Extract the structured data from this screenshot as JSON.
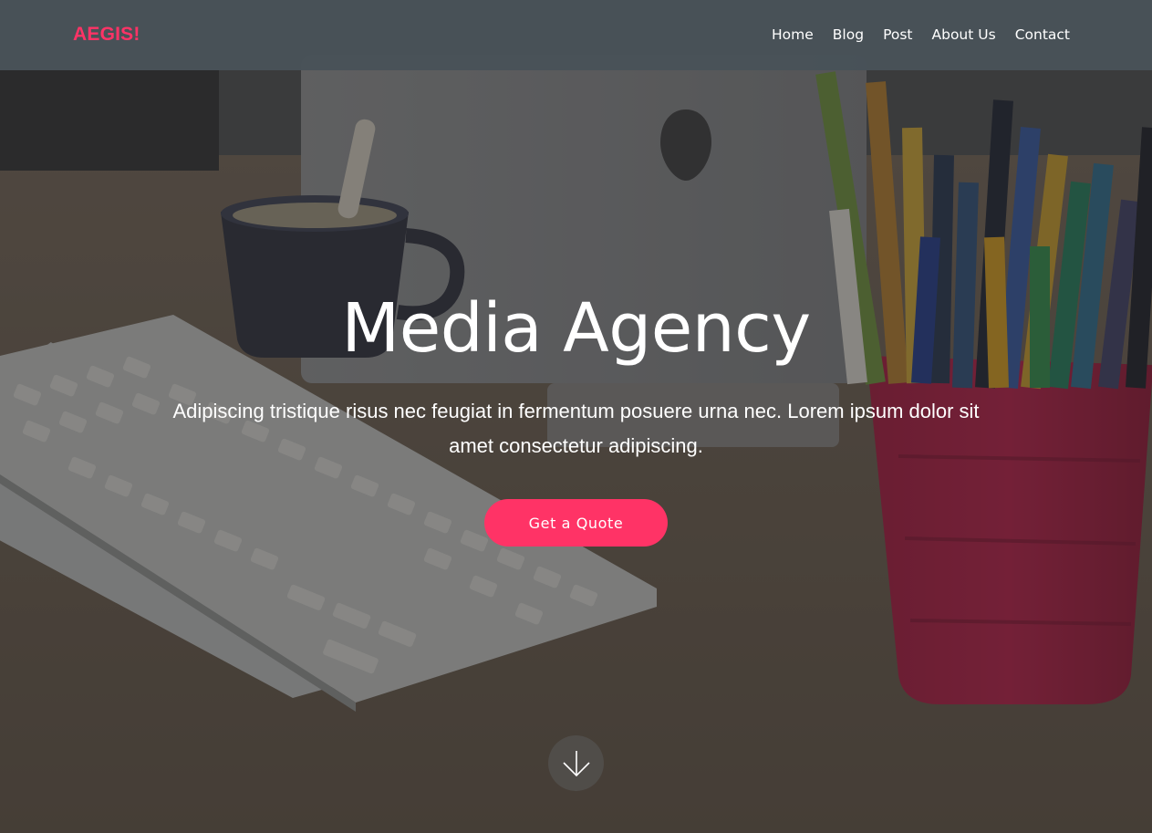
{
  "brand": {
    "logo_text": "AEGIS!",
    "accent_color": "#ff3366"
  },
  "nav": {
    "items": [
      {
        "label": "Home"
      },
      {
        "label": "Blog"
      },
      {
        "label": "Post"
      },
      {
        "label": "About Us"
      },
      {
        "label": "Contact"
      }
    ]
  },
  "hero": {
    "title": "Media Agency",
    "subtitle": "Adipiscing tristique risus nec feugiat in fermentum posuere urna nec. Lorem ipsum dolor sit amet consectetur adipiscing.",
    "cta_label": "Get a Quote",
    "scroll_icon": "arrow-down-icon"
  }
}
